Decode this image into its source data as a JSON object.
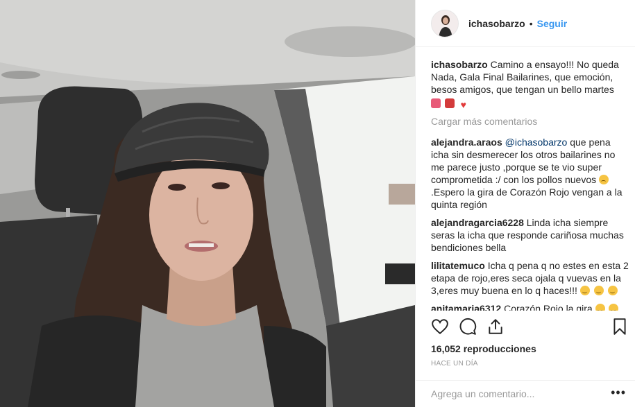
{
  "header": {
    "username": "ichasobarzo",
    "separator": "•",
    "follow_label": "Seguir"
  },
  "caption": {
    "username": "ichasobarzo",
    "text": "Camino a ensayo!!! No queda Nada, Gala Final Bailarines, que emoción, besos amigos, que tengan un bello martes"
  },
  "load_more_label": "Cargar más comentarios",
  "comments": [
    {
      "username": "alejandra.araos",
      "mention": "@ichasobarzo",
      "text_before_emoji": "que pena icha sin desmerecer los otros bailarines no me parece justo ,porque se te vio super comprometida :/ con los pollos nuevos",
      "text_after_emoji": ".Espero la gira de Corazón Rojo vengan a la quinta región"
    },
    {
      "username": "alejandragarcia6228",
      "text": "Linda icha siempre seras la icha que responde cariñosa muchas bendiciones bella"
    },
    {
      "username": "lilitatemuco",
      "text": "Icha q pena q no estes en esta 2 etapa de rojo,eres seca ojala q vuevas en la 3,eres muy buena en lo q haces!!!"
    },
    {
      "username": "anitamaria6312",
      "text": "Corazón Rojo la gira"
    }
  ],
  "actions": {
    "like_icon": "heart-outline",
    "comment_icon": "speech-bubble",
    "share_icon": "upload-arrow",
    "save_icon": "bookmark"
  },
  "views_text": "16,052 reproducciones",
  "timestamp": "HACE UN DÍA",
  "composer": {
    "placeholder": "Agrega un comentario...",
    "more_label": "•••"
  },
  "colors": {
    "link_blue": "#3897f0",
    "mention_blue": "#003569",
    "muted_gray": "#999999"
  }
}
